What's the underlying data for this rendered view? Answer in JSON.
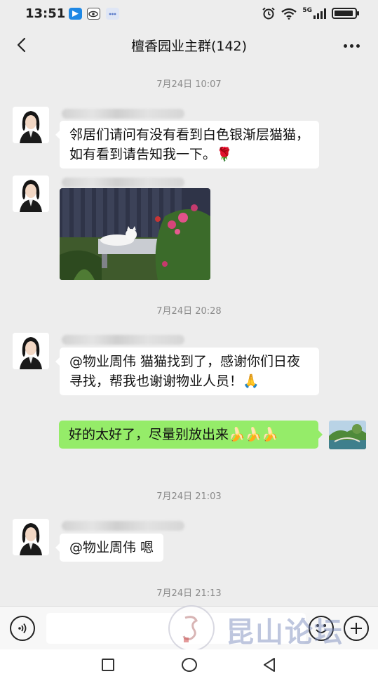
{
  "status_bar": {
    "time": "13:51",
    "network": "5G",
    "icons": [
      "app-notification-icon",
      "eye-app-icon",
      "chat-app-icon",
      "alarm-icon",
      "wifi-icon",
      "signal-icon",
      "battery-icon"
    ]
  },
  "header": {
    "title": "檀香园业主群(142)",
    "back_icon": "chevron-left-icon",
    "more_icon": "more-dots-icon"
  },
  "messages": {
    "ts1": "7月24日 10:07",
    "m1_text": "邻居们请问有没有看到白色银渐层猫猫，如有看到请告知我一下。🌹",
    "m2_image_desc": "white-cat-on-bench-photo",
    "ts2": "7月24日 20:28",
    "m3_text": "@物业周伟  猫猫找到了，感谢你们日夜寻找，帮我也谢谢物业人员！🙏",
    "m4_text": "好的太好了，尽量别放出来🍌🍌🍌",
    "ts3": "7月24日 21:03",
    "m5_text": "@物业周伟  嗯",
    "ts4": "7月24日 21:13"
  },
  "input_bar": {
    "value": "",
    "voice_icon": "voice-icon",
    "emoji_icon": "emoji-icon",
    "plus_icon": "plus-icon"
  },
  "watermark": {
    "text": "昆山论坛"
  },
  "nav_bar": {
    "icons": [
      "recent-apps-icon",
      "home-icon",
      "back-triangle-icon"
    ]
  },
  "colors": {
    "background": "#ededed",
    "self_bubble": "#95ec69",
    "other_bubble": "#ffffff",
    "accent_blue": "#1e88e5"
  }
}
